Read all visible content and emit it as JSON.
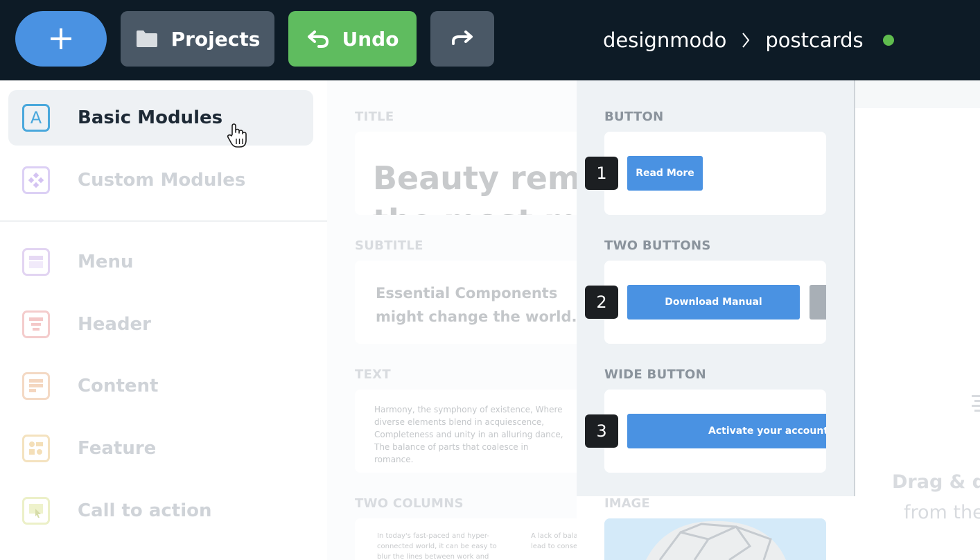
{
  "toolbar": {
    "add_label": "+",
    "projects_label": "Projects",
    "undo_label": "Undo",
    "breadcrumb_workspace": "designmodo",
    "breadcrumb_project": "postcards",
    "status_color": "#5fbc4e"
  },
  "sidebar": {
    "items": [
      {
        "label": "Basic Modules",
        "icon": "letter-a-icon",
        "active": true
      },
      {
        "label": "Custom Modules",
        "icon": "diamond-grid-icon"
      },
      {
        "label": "Menu",
        "icon": "menu-layout-icon"
      },
      {
        "label": "Header",
        "icon": "header-layout-icon"
      },
      {
        "label": "Content",
        "icon": "content-layout-icon"
      },
      {
        "label": "Feature",
        "icon": "feature-layout-icon"
      },
      {
        "label": "Call to action",
        "icon": "cta-pointer-icon"
      }
    ],
    "basic_icon_letter": "A"
  },
  "modules": {
    "title_label": "TITLE",
    "title_text": "Beauty remains in the most mundane",
    "subtitle_label": "SUBTITLE",
    "subtitle_text": "Essential Components might change the world.",
    "text_label": "TEXT",
    "text_body": "Harmony, the symphony of existence, Where diverse elements blend in acquiescence, Completeness and unity in an alluring dance, The balance of parts that coalesce in romance.",
    "two_columns_label": "TWO COLUMNS",
    "col1_text": "In today's fast-paced and hyper-connected world, it can be easy to blur the lines between work and personal",
    "col2_text": "A lack of balance in life can lead to consequences"
  },
  "panel": {
    "button_label": "BUTTON",
    "two_buttons_label": "TWO BUTTONS",
    "wide_button_label": "WIDE BUTTON",
    "image_label": "IMAGE",
    "badge_1": "1",
    "badge_2": "2",
    "badge_3": "3",
    "read_more": "Read More",
    "download_manual": "Download Manual",
    "activate_account": "Activate your account"
  },
  "canvas": {
    "drag_title": "Drag & drop",
    "drag_sub": "from the"
  },
  "colors": {
    "topbar_bg": "#0d1b26",
    "accent_blue": "#4a92e2",
    "undo_green": "#5fbc5f",
    "secondary_gray": "#4a5866"
  }
}
